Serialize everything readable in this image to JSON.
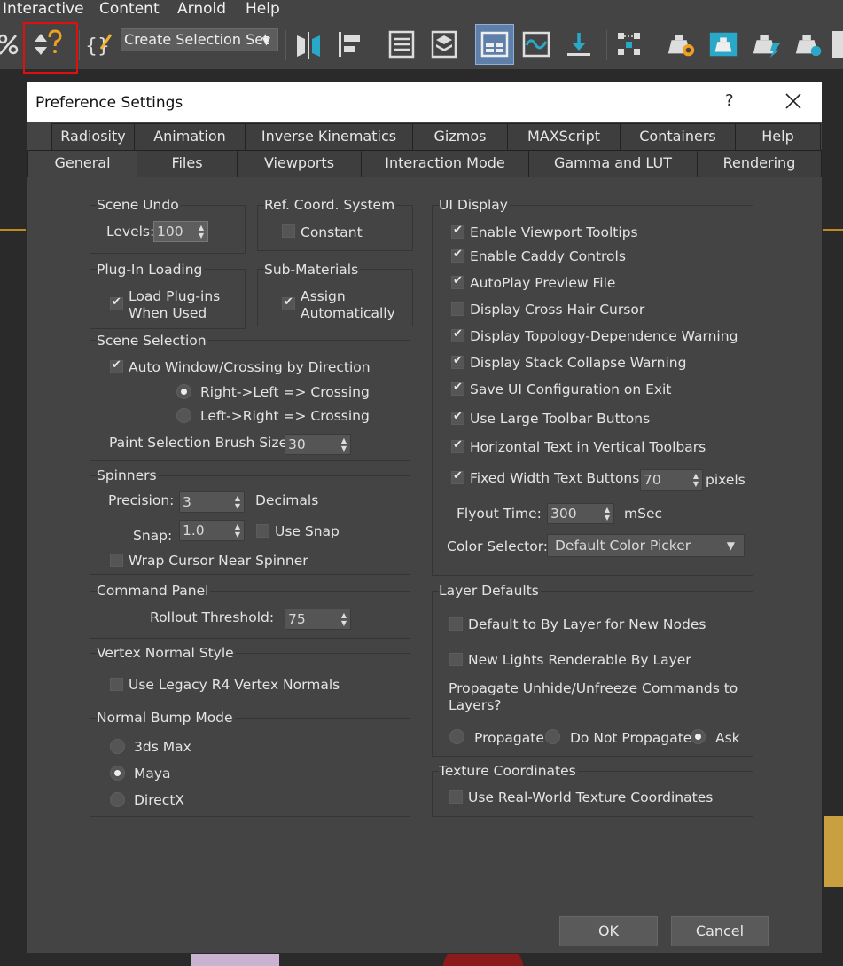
{
  "app": {
    "menu": [
      "Interactive",
      "Content",
      "Arnold",
      "Help"
    ],
    "selection_set_placeholder": "Create Selection Set"
  },
  "dialog": {
    "title": "Preference Settings",
    "help_glyph": "?",
    "tabs_row1": [
      "Radiosity",
      "Animation",
      "Inverse Kinematics",
      "Gizmos",
      "MAXScript",
      "Containers",
      "Help"
    ],
    "tabs_row2": [
      "General",
      "Files",
      "Viewports",
      "Interaction Mode",
      "Gamma and LUT",
      "Rendering"
    ],
    "active_tab": "General",
    "scene_undo": {
      "title": "Scene Undo",
      "levels_label": "Levels:",
      "levels_value": "100"
    },
    "ref_coord": {
      "title": "Ref. Coord. System",
      "constant_label": "Constant",
      "constant_checked": false
    },
    "plugin_loading": {
      "title": "Plug-In Loading",
      "label_line1": "Load Plug-ins",
      "label_line2": "When Used",
      "checked": true
    },
    "sub_materials": {
      "title": "Sub-Materials",
      "label_line1": "Assign",
      "label_line2": "Automatically",
      "checked": true
    },
    "scene_selection": {
      "title": "Scene Selection",
      "auto_window_label": "Auto Window/Crossing by Direction",
      "auto_window_checked": true,
      "right_left_label": "Right->Left => Crossing",
      "left_right_label": "Left->Right => Crossing",
      "selected_direction": "right_left",
      "brush_label": "Paint Selection Brush Size",
      "brush_value": "30"
    },
    "spinners": {
      "title": "Spinners",
      "precision_label": "Precision:",
      "precision_value": "3",
      "decimals_label": "Decimals",
      "snap_label": "Snap:",
      "snap_value": "1.0",
      "use_snap_label": "Use Snap",
      "use_snap_checked": false,
      "wrap_label": "Wrap Cursor Near Spinner",
      "wrap_checked": false
    },
    "command_panel": {
      "title": "Command Panel",
      "rollout_label": "Rollout Threshold:",
      "rollout_value": "75"
    },
    "vertex_normal": {
      "title": "Vertex Normal Style",
      "legacy_label": "Use Legacy R4 Vertex Normals",
      "legacy_checked": false
    },
    "normal_bump": {
      "title": "Normal Bump Mode",
      "options": [
        "3ds Max",
        "Maya",
        "DirectX"
      ],
      "selected": "Maya"
    },
    "ui_display": {
      "title": "UI Display",
      "items": [
        {
          "label": "Enable Viewport Tooltips",
          "checked": true
        },
        {
          "label": "Enable Caddy Controls",
          "checked": true
        },
        {
          "label": "AutoPlay Preview File",
          "checked": true
        },
        {
          "label": "Display Cross Hair Cursor",
          "checked": false
        },
        {
          "label": "Display Topology-Dependence Warning",
          "checked": true
        },
        {
          "label": "Display Stack Collapse Warning",
          "checked": true
        },
        {
          "label": "Save UI Configuration on Exit",
          "checked": true
        },
        {
          "label": "Use Large Toolbar Buttons",
          "checked": true
        },
        {
          "label": "Horizontal Text in Vertical Toolbars",
          "checked": true
        }
      ],
      "fixed_width_label": "Fixed Width Text Buttons:",
      "fixed_width_checked": true,
      "fixed_width_value": "70",
      "pixels_label": "pixels",
      "flyout_label": "Flyout Time:",
      "flyout_value": "300",
      "msec_label": "mSec",
      "color_selector_label": "Color Selector:",
      "color_selector_value": "Default Color Picker"
    },
    "layer_defaults": {
      "title": "Layer Defaults",
      "by_layer_label": "Default to By Layer for New Nodes",
      "by_layer_checked": false,
      "lights_label": "New Lights Renderable By Layer",
      "lights_checked": false,
      "propagate_line1": "Propagate Unhide/Unfreeze Commands to",
      "propagate_line2": "Layers?",
      "propagate_options": [
        "Propagate",
        "Do Not Propagate",
        "Ask"
      ],
      "propagate_selected": "Ask"
    },
    "texture_coords": {
      "title": "Texture Coordinates",
      "real_world_label": "Use Real-World Texture Coordinates",
      "real_world_checked": false
    },
    "ok_label": "OK",
    "cancel_label": "Cancel"
  }
}
